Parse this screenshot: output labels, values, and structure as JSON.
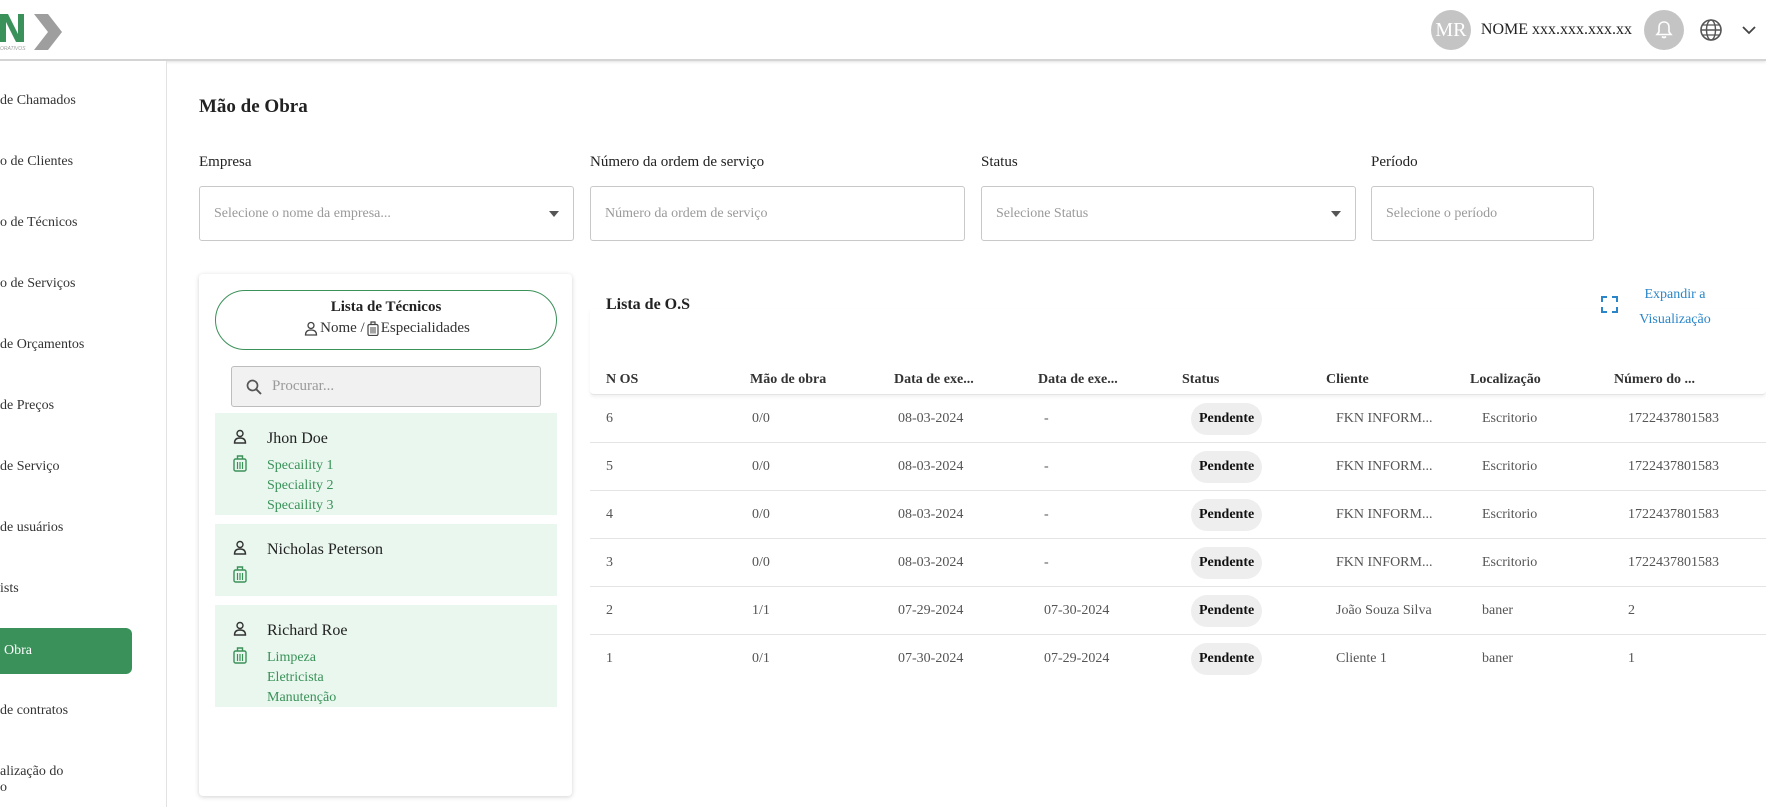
{
  "header": {
    "avatar_initials": "MR",
    "user_name": "NOME xxx.xxx.xxx.xx"
  },
  "sidebar": {
    "items": [
      {
        "label": "de Chamados"
      },
      {
        "label": "o de Clientes"
      },
      {
        "label": "o de Técnicos"
      },
      {
        "label": "o de Serviços"
      },
      {
        "label": "de Orçamentos"
      },
      {
        "label": "de Preços"
      },
      {
        "label": "de Serviço"
      },
      {
        "label": "de usuários"
      },
      {
        "label": "ists"
      },
      {
        "label": "Obra",
        "active": true
      },
      {
        "label": "de contratos"
      },
      {
        "label_line1": "alização do",
        "label_line2": "o"
      }
    ]
  },
  "page": {
    "title": "Mão de Obra"
  },
  "filters": {
    "empresa_label": "Empresa",
    "empresa_placeholder": "Selecione o nome da empresa...",
    "os_label": "Número da ordem de serviço",
    "os_placeholder": "Número da ordem de serviço",
    "status_label": "Status",
    "status_placeholder": "Selecione Status",
    "periodo_label": "Período",
    "periodo_placeholder": "Selecione o período"
  },
  "technicians": {
    "title": "Lista de Técnicos",
    "sub_name": "Nome /",
    "sub_spec": "Especialidades",
    "search_placeholder": "Procurar...",
    "items": [
      {
        "name": "Jhon Doe",
        "specialities": [
          "Specaility 1",
          "Speciality 2",
          "Specaility 3"
        ]
      },
      {
        "name": "Nicholas Peterson",
        "specialities": []
      },
      {
        "name": "Richard Roe",
        "specialities": [
          "Limpeza",
          "Eletricista",
          "Manutenção"
        ]
      }
    ]
  },
  "os_list": {
    "title": "Lista de O.S",
    "expand_line1": "Expandir a",
    "expand_line2": "Visualização",
    "columns": [
      "N OS",
      "Mão de obra",
      "Data de exe...",
      "Data de exe...",
      "Status",
      "Cliente",
      "Localização",
      "Número do ..."
    ],
    "rows": [
      {
        "n_os": "6",
        "mao_obra": "0/0",
        "data1": "08-03-2024",
        "data2": "-",
        "status": "Pendente",
        "cliente": "FKN INFORM...",
        "localizacao": "Escritorio",
        "numero": "1722437801583"
      },
      {
        "n_os": "5",
        "mao_obra": "0/0",
        "data1": "08-03-2024",
        "data2": "-",
        "status": "Pendente",
        "cliente": "FKN INFORM...",
        "localizacao": "Escritorio",
        "numero": "1722437801583"
      },
      {
        "n_os": "4",
        "mao_obra": "0/0",
        "data1": "08-03-2024",
        "data2": "-",
        "status": "Pendente",
        "cliente": "FKN INFORM...",
        "localizacao": "Escritorio",
        "numero": "1722437801583"
      },
      {
        "n_os": "3",
        "mao_obra": "0/0",
        "data1": "08-03-2024",
        "data2": "-",
        "status": "Pendente",
        "cliente": "FKN INFORM...",
        "localizacao": "Escritorio",
        "numero": "1722437801583"
      },
      {
        "n_os": "2",
        "mao_obra": "1/1",
        "data1": "07-29-2024",
        "data2": "07-30-2024",
        "status": "Pendente",
        "cliente": "João Souza Silva",
        "localizacao": "baner",
        "numero": "2"
      },
      {
        "n_os": "1",
        "mao_obra": "0/1",
        "data1": "07-30-2024",
        "data2": "07-29-2024",
        "status": "Pendente",
        "cliente": "Cliente 1",
        "localizacao": "baner",
        "numero": "1"
      }
    ]
  },
  "colors": {
    "brand_green": "#3a9159",
    "card_bg": "#e9f7ee",
    "link_blue": "#2a86c9"
  }
}
